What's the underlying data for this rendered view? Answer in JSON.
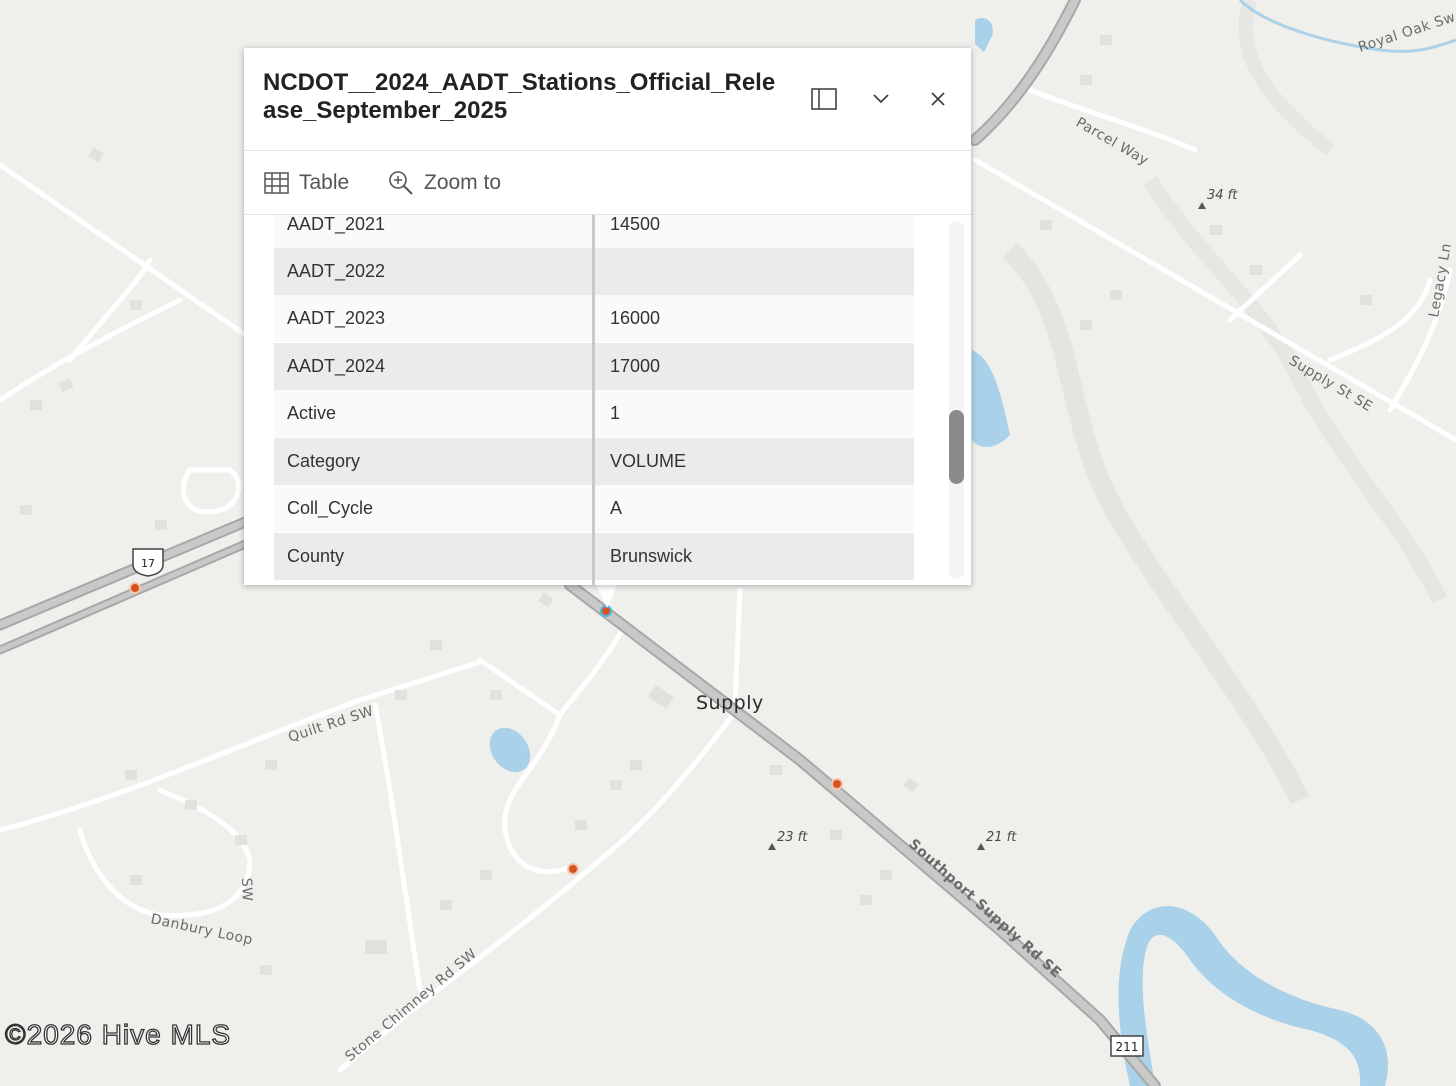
{
  "popup": {
    "title": "NCDOT__2024_AADT_Stations_Official_Release_September_2025",
    "actions": {
      "table": "Table",
      "zoom_to": "Zoom to"
    },
    "rows": [
      {
        "field": "AADT_2021",
        "value": "14500"
      },
      {
        "field": "AADT_2022",
        "value": ""
      },
      {
        "field": "AADT_2023",
        "value": "16000"
      },
      {
        "field": "AADT_2024",
        "value": "17000"
      },
      {
        "field": "Active",
        "value": "1"
      },
      {
        "field": "Category",
        "value": "VOLUME"
      },
      {
        "field": "Coll_Cycle",
        "value": "A"
      },
      {
        "field": "County",
        "value": "Brunswick"
      }
    ]
  },
  "map": {
    "labels": {
      "royal_oak": "Royal Oak Sw",
      "parcel_way": "Parcel Way",
      "legacy_ln": "Legacy Ln",
      "supply_st": "Supply St SE",
      "quilt_rd": "Quilt Rd SW",
      "danbury": "Danbury Loop",
      "danbury_sw": "SW",
      "stone_chimney": "Stone Chimney Rd SW",
      "southport": "Southport Supply Rd SE",
      "town": "Supply"
    },
    "elevations": {
      "e34": "34 ft",
      "e23": "23 ft",
      "e21": "21 ft"
    },
    "shields": {
      "us17": "17",
      "nc211": "211"
    },
    "colors": {
      "water": "#a9d2ea",
      "highway": "#bdbdbd",
      "marker": "#d5531f"
    }
  },
  "copyright": "©2026 Hive MLS"
}
